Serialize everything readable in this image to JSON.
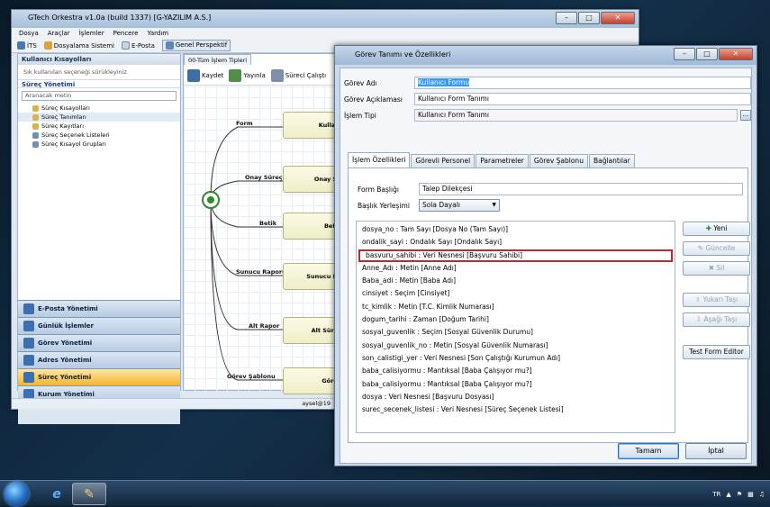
{
  "main_window": {
    "title": "GTech Orkestra v1.0a (build 1337) [G-YAZILIM A.S.]",
    "menu": [
      "Dosya",
      "Araçlar",
      "İşlemler",
      "Pencere",
      "Yardım"
    ],
    "toolbar": [
      "İTS",
      "Dosyalama Sistemi",
      "E-Posta",
      "Genel Perspektif"
    ],
    "left_panel": {
      "header": "Kullanıcı Kısayolları",
      "hint": "Sık kullanılan seçeneği sürükleyiniz",
      "section": "Süreç Yönetimi",
      "search_placeholder": "Aranacak metin",
      "items": [
        "Süreç Kısayolları",
        "Süreç Tanımları",
        "Süreç Kayıtları",
        "Süreç Seçenek Listeleri",
        "Süreç Kısayol Grupları"
      ],
      "nav": [
        "E-Posta Yönetimi",
        "Günlük İşlemler",
        "Görev Yönetimi",
        "Adres Yönetimi",
        "Süreç Yönetimi",
        "Kurum Yönetimi"
      ]
    },
    "editor": {
      "tab": "00-Tüm İşlem Tipleri",
      "tools": [
        "Kaydet",
        "Yayınla",
        "Süreci Çalıştı"
      ],
      "edges": [
        "Form",
        "Onay Süreç",
        "Betik",
        "Sunucu Raporu",
        "Alt Rapor",
        "Görev Şablonu"
      ],
      "nodes": [
        "Kullanı",
        "Onay Sü",
        "Betik",
        "Sunucu Ra",
        "Alt Süreç",
        "Görev"
      ]
    },
    "status": "aysel@19"
  },
  "dialog": {
    "title": "Görev Tanımı ve Özellikleri",
    "fields": {
      "gorev_adi_label": "Görev Adı",
      "gorev_adi_value": "Kullanıcı Formu",
      "gorev_aciklamasi_label": "Görev Açıklaması",
      "gorev_aciklamasi_value": "Kullanıcı Form Tanımı",
      "islem_tipi_label": "İşlem Tipi",
      "islem_tipi_value": "Kullanıcı Form Tanımı"
    },
    "tabs": [
      "İşlem Özellikleri",
      "Görevli Personel",
      "Parametreler",
      "Görev Şablonu",
      "Bağlantılar"
    ],
    "form_basligi_label": "Form Başlığı",
    "form_basligi_value": "Talep Dilekçesi",
    "baslik_yerlesimi_label": "Başlık Yerleşimi",
    "baslik_yerlesimi_value": "Sola Dayalı",
    "list_items": [
      "dosya_no : Tam Sayı [Dosya No (Tam Sayı)]",
      "ondalik_sayi : Ondalık Sayı [Ondalık Sayı]",
      "basvuru_sahibi : Veri Nesnesi [Başvuru Sahibi]",
      "Anne_Adı : Metin [Anne Adı]",
      "Baba_adi : Metin [Baba Adı]",
      "cinsiyet : Seçim [Cinsiyet]",
      "tc_kimlik : Metin [T.C. Kimlik Numarası]",
      "dogum_tarihi : Zaman [Doğum Tarihi]",
      "sosyal_guvenlik : Seçim [Sosyal Güvenlik Durumu]",
      "sosyal_guvenlik_no : Metin [Sosyal Güvenlik Numarası]",
      "son_calistigi_yer : Veri Nesnesi [Son Çalıştığı Kurumun Adı]",
      "baba_calisiyormu : Mantıksal [Baba Çalışıyor mu?]",
      "baba_calisiyormu : Mantıksal [Baba Çalışıyor mu?]",
      "dosya : Veri Nesnesi [Başvuru Dosyası]",
      "surec_secenek_listesi : Veri Nesnesi [Süreç Seçenek Listesi]"
    ],
    "side_buttons": {
      "yeni": "Yeni",
      "guncelle": "Güncelle",
      "sil": "Sil",
      "yukari": "Yukarı Taşı",
      "asagi": "Aşağı Taşı",
      "test": "Test Form Editor"
    },
    "ok": "Tamam",
    "cancel": "İptal"
  },
  "taskbar": {
    "lang": "TR"
  }
}
